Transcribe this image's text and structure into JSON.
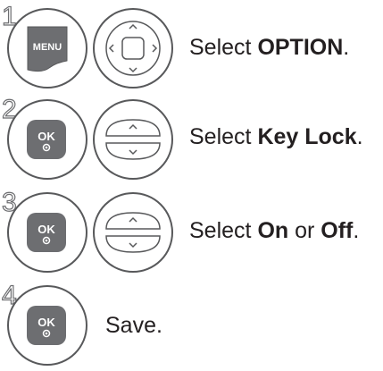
{
  "steps": [
    {
      "number": "1",
      "buttons": [
        "menu-button-icon",
        "navigation-dpad-icon"
      ],
      "menu_label": "MENU",
      "instruction": {
        "prefix": "Select ",
        "bold": "OPTION",
        "suffix": "."
      }
    },
    {
      "number": "2",
      "buttons": [
        "ok-button-icon",
        "up-down-rocker-icon"
      ],
      "ok_label": "OK",
      "instruction": {
        "prefix": "Select ",
        "bold": "Key Lock",
        "suffix": "."
      }
    },
    {
      "number": "3",
      "buttons": [
        "ok-button-icon",
        "up-down-rocker-icon"
      ],
      "ok_label": "OK",
      "instruction": {
        "prefix": "Select ",
        "bold1": "On",
        "middle": " or ",
        "bold2": "Off",
        "suffix": "."
      }
    },
    {
      "number": "4",
      "buttons": [
        "ok-button-icon"
      ],
      "ok_label": "OK",
      "instruction": {
        "text": "Save."
      }
    }
  ],
  "colors": {
    "button_outline": "#58595b",
    "button_fill": "#6d6e71",
    "text": "#231f20"
  }
}
